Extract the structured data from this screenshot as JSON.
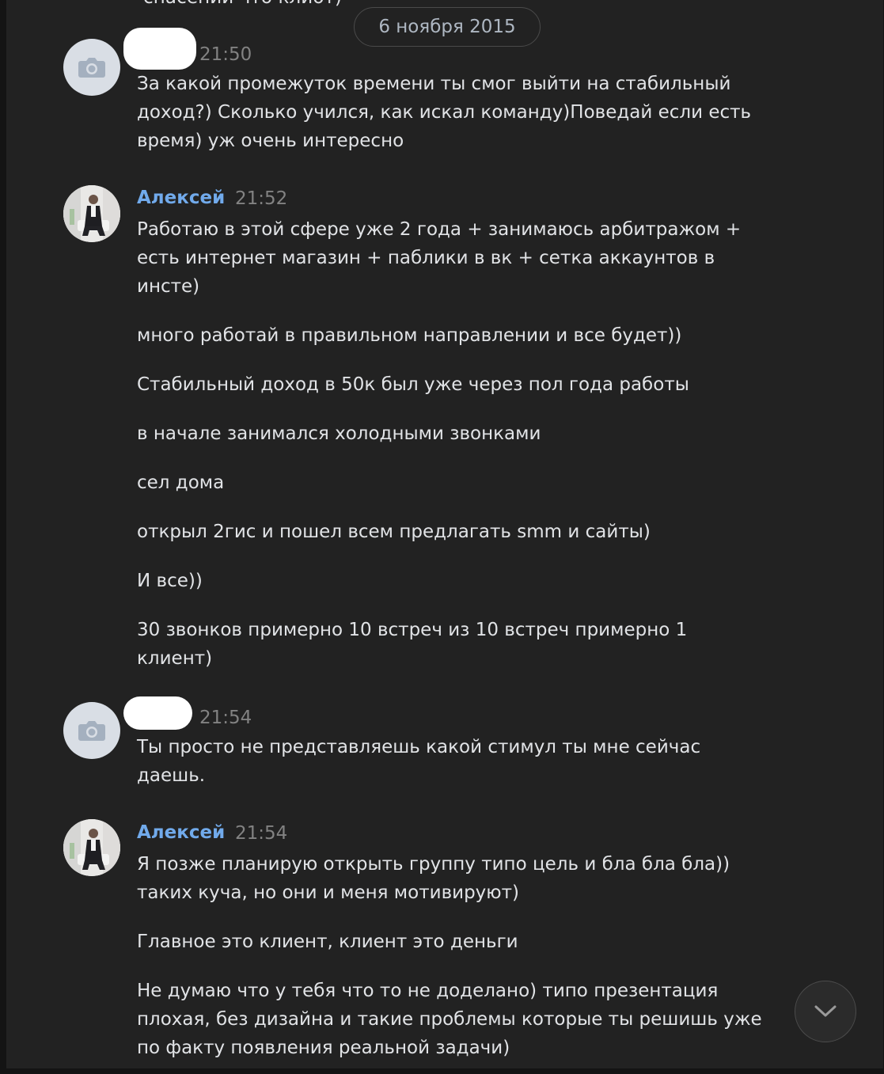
{
  "history": {
    "cut_text": "спасении  что клиот)"
  },
  "date_separator": "6 ноября 2015",
  "messages": [
    {
      "time": "21:50",
      "paragraphs": [
        "За какой промежуток времени ты смог выйти на стабильный доход?) Сколько учился, как искал команду)Поведай если есть время) уж очень интересно"
      ]
    },
    {
      "author": "Алексей",
      "time": "21:52",
      "paragraphs": [
        "Работаю в этой сфере уже 2 года + занимаюсь арбитражом + есть интернет магазин + паблики в вк + сетка аккаунтов в инсте)",
        "много работай в правильном направлении и все будет))",
        "Стабильный доход в 50к был уже через пол года работы",
        "в начале занимался холодными звонками",
        "сел дома",
        "открыл 2гис и пошел всем предлагать smm и сайты)",
        "И все))",
        "30 звонков примерно 10 встреч из 10 встреч примерно 1 клиент)"
      ]
    },
    {
      "time": "21:54",
      "paragraphs": [
        "Ты просто не представляешь какой стимул ты мне сейчас даешь."
      ]
    },
    {
      "author": "Алексей",
      "time": "21:54",
      "paragraphs": [
        "Я позже планирую открыть группу типо цель и бла бла бла)) таких куча, но они и меня мотивируют)",
        "Главное это клиент, клиент это деньги",
        "Не думаю что у тебя что то не доделано) типо презентация плохая, без дизайна и такие проблемы которые ты решишь уже по факту появления реальной задачи)"
      ]
    }
  ],
  "icons": {
    "avatar_placeholder": "camera-icon",
    "scroll_down": "chevron-down-icon"
  },
  "colors": {
    "background": "#222222",
    "author": "#71aaeb",
    "text": "#e1e3e6",
    "time": "#828282"
  }
}
